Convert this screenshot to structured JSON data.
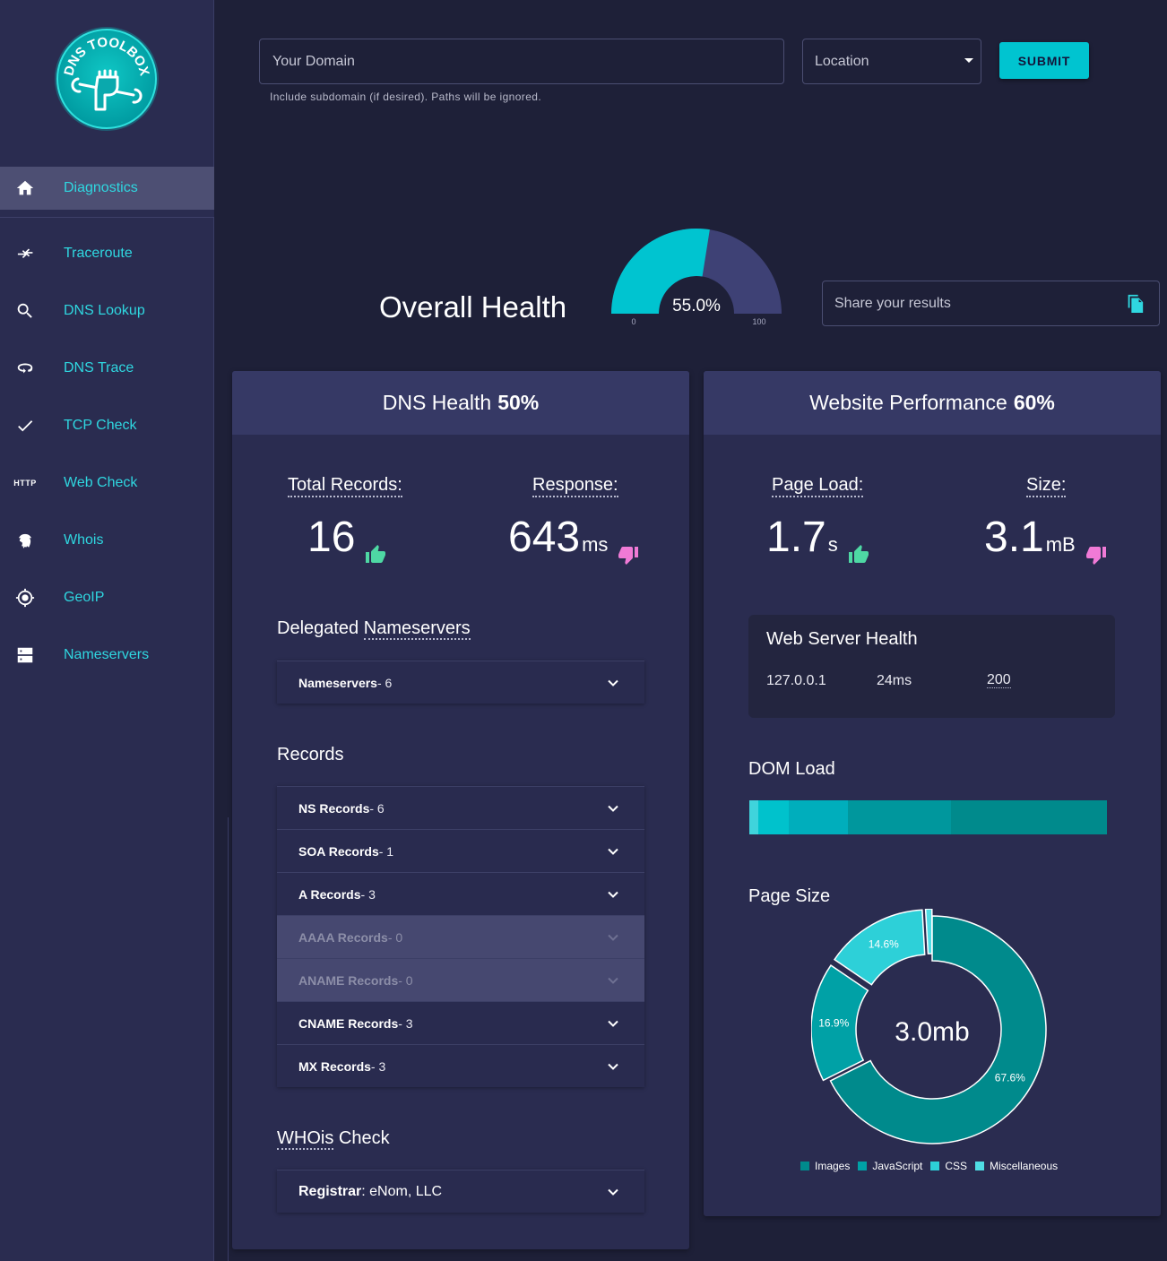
{
  "logo": {
    "text": "DNS TOOLBOX"
  },
  "nav": [
    {
      "label": "Diagnostics",
      "icon": "home-icon",
      "active": true
    },
    {
      "label": "Traceroute",
      "icon": "arrows-icon"
    },
    {
      "label": "DNS Lookup",
      "icon": "search-icon"
    },
    {
      "label": "DNS Trace",
      "icon": "loop-icon"
    },
    {
      "label": "TCP Check",
      "icon": "check-icon"
    },
    {
      "label": "Web Check",
      "icon": "http-icon",
      "icon_text": "HTTP"
    },
    {
      "label": "Whois",
      "icon": "fingerprint-icon"
    },
    {
      "label": "GeoIP",
      "icon": "crosshair-icon"
    },
    {
      "label": "Nameservers",
      "icon": "server-icon"
    }
  ],
  "form": {
    "domain_placeholder": "Your Domain",
    "domain_help": "Include subdomain (if desired). Paths will be ignored.",
    "location_placeholder": "Location",
    "submit_label": "SUBMIT"
  },
  "overall": {
    "title": "Overall Health",
    "value": 55.0,
    "value_text": "55.0%",
    "min_label": "0",
    "max_label": "100"
  },
  "share": {
    "placeholder": "Share your results"
  },
  "dns_card": {
    "title": "DNS Health",
    "score": "50%",
    "total_records_label": "Total Records:",
    "total_records_value": "16",
    "response_label": "Response:",
    "response_value": "643",
    "response_unit": "ms",
    "delegated_title_a": "Delegated",
    "delegated_title_b": "Nameservers",
    "nameservers_row": {
      "label": "Nameservers",
      "count": " - 6"
    },
    "records_title": "Records",
    "records": [
      {
        "label": "NS Records",
        "count": " - 6",
        "disabled": false
      },
      {
        "label": "SOA Records",
        "count": " - 1",
        "disabled": false
      },
      {
        "label": "A Records",
        "count": " - 3",
        "disabled": false
      },
      {
        "label": "AAAA Records",
        "count": " - 0",
        "disabled": true
      },
      {
        "label": "ANAME Records",
        "count": " - 0",
        "disabled": true
      },
      {
        "label": "CNAME Records",
        "count": " - 3",
        "disabled": false
      },
      {
        "label": "MX Records",
        "count": " - 3",
        "disabled": false
      }
    ],
    "whois_title_a": "WHOis",
    "whois_title_b": " Check",
    "registrar_label": "Registrar",
    "registrar_value": ": eNom, LLC"
  },
  "perf_card": {
    "title": "Website Performance",
    "score": "60%",
    "page_load_label": "Page Load:",
    "page_load_value": "1.7",
    "page_load_unit": "s",
    "size_label": "Size:",
    "size_value": "3.1",
    "size_unit": "mB",
    "web_server_title": "Web Server Health",
    "web_server_ip": "127.0.0.1",
    "web_server_time": "24ms",
    "web_server_status": "200",
    "dom_load_title": "DOM Load",
    "dom_load_segments": [
      {
        "fraction": 0.025,
        "color": "#3fd4dc"
      },
      {
        "fraction": 0.085,
        "color": "#00c2cc"
      },
      {
        "fraction": 0.165,
        "color": "#00aebc"
      },
      {
        "fraction": 0.29,
        "color": "#00979d"
      },
      {
        "fraction": 0.435,
        "color": "#008a8c"
      }
    ],
    "page_size_title": "Page Size",
    "page_size_total": "3.0mb"
  },
  "chart_data": {
    "type": "pie",
    "title": "Page Size",
    "center_label": "3.0mb",
    "categories": [
      "Images",
      "JavaScript",
      "CSS",
      "Miscellaneous"
    ],
    "values": [
      67.6,
      16.9,
      14.6,
      0.9
    ],
    "labels": [
      "67.6%",
      "16.9%",
      "14.6%",
      ""
    ],
    "colors": [
      "#008a8c",
      "#00a1a6",
      "#2dd0d8",
      "#4fdde4"
    ],
    "legend_position": "bottom"
  },
  "colors": {
    "accent": "#00c4d0",
    "thumb_up": "#4ed8a4",
    "thumb_down": "#f07ad6",
    "gauge_fill": "#00c4d0",
    "gauge_track": "#3e4175"
  }
}
